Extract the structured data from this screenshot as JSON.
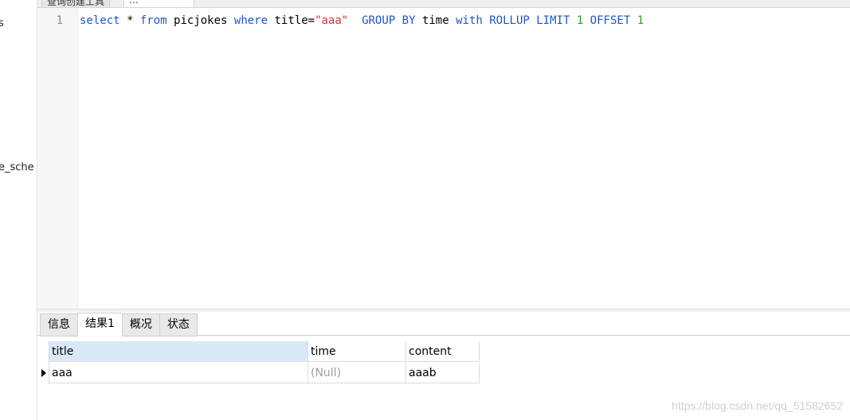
{
  "sidebar": {
    "items": [
      {
        "label": "s"
      },
      {
        "label": "e_sche"
      }
    ]
  },
  "top_tabs": [
    {
      "label": "查询创建工具"
    },
    {
      "label": "…"
    }
  ],
  "editor": {
    "line_number": "1",
    "tokens": {
      "select": "select",
      "star": " * ",
      "from": "from",
      "table": " picjokes ",
      "where": "where",
      "cond": " title=",
      "value": "\"aaa\"",
      "group_by": "  GROUP BY",
      "col": " time ",
      "with": "with",
      "rollup": " ROLLUP LIMIT",
      "limit_n": " 1",
      "offset": " OFFSET",
      "offset_n": " 1"
    }
  },
  "result_tabs": [
    {
      "label": "信息",
      "active": false
    },
    {
      "label": "结果1",
      "active": true
    },
    {
      "label": "概况",
      "active": false
    },
    {
      "label": "状态",
      "active": false
    }
  ],
  "grid": {
    "columns": [
      "title",
      "time",
      "content"
    ],
    "rows": [
      {
        "title": "aaa",
        "time": "(Null)",
        "content": "aaab"
      }
    ]
  },
  "watermark": "https://blog.csdn.net/qq_51582652",
  "colors": {
    "keyword": "#1f56c2",
    "string": "#c83a3a",
    "number": "#2e9a2e",
    "header_selected": "#d9e9f8"
  }
}
